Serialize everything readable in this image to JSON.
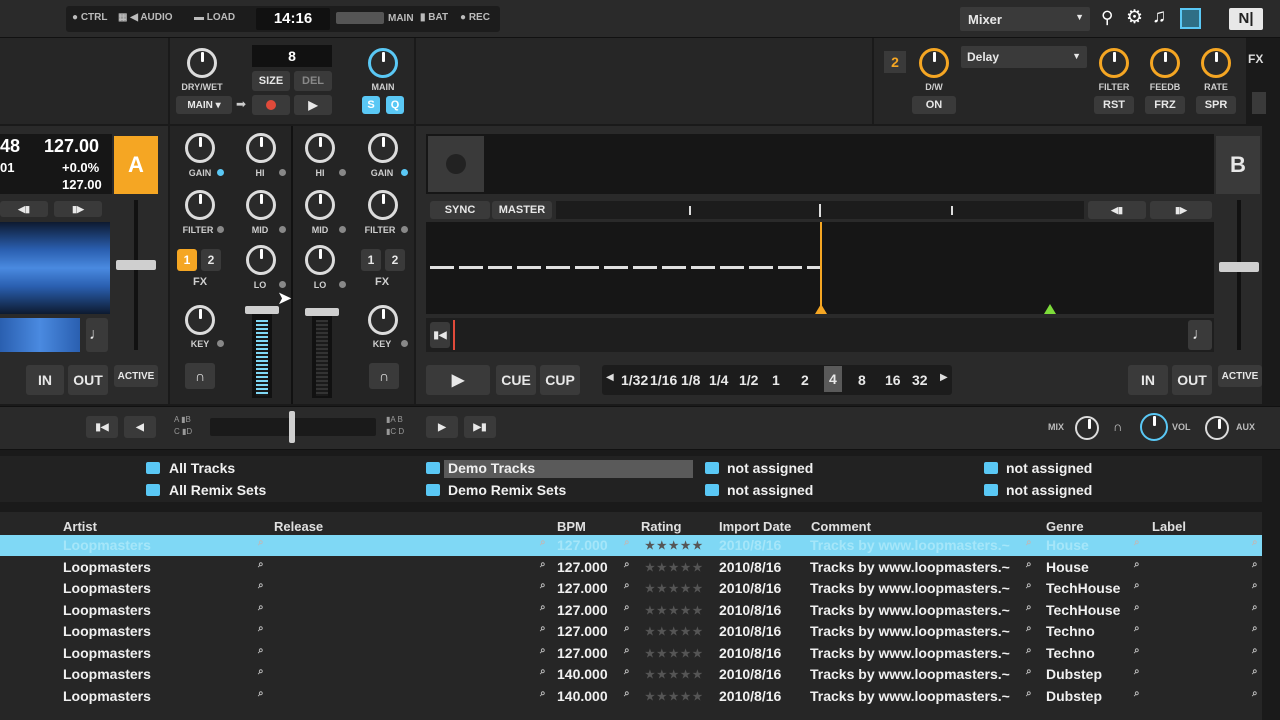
{
  "topbar": {
    "ctrl": "CTRL",
    "audio": "AUDIO",
    "load": "LOAD",
    "time": "14:16",
    "main": "MAIN",
    "bat": "BAT",
    "rec": "REC",
    "layout_select": "Mixer"
  },
  "fx1": {
    "drywet": "DRY/WET",
    "beats": "8",
    "size": "SIZE",
    "del": "DEL",
    "main_select": "MAIN",
    "main_knob": "MAIN",
    "s": "S",
    "q": "Q"
  },
  "fx2": {
    "unit": "2",
    "effect": "Delay",
    "dw": "D/W",
    "on": "ON",
    "filter": "FILTER",
    "feedb": "FEEDB",
    "rate": "RATE",
    "rst": "RST",
    "frz": "FRZ",
    "spr": "SPR",
    "fx_tab": "FX"
  },
  "deckA": {
    "bpm": "127.00",
    "pitch": "+0.0%",
    "tempo": "127.00",
    "pos1": "48",
    "pos2": "01",
    "letter": "A",
    "in": "IN",
    "out": "OUT",
    "active": "ACTIVE"
  },
  "mixer": {
    "gain": "GAIN",
    "hi": "HI",
    "mid": "MID",
    "lo": "LO",
    "filter": "FILTER",
    "fx": "FX",
    "key": "KEY",
    "fx1": "1",
    "fx2": "2"
  },
  "deckB": {
    "letter": "B",
    "sync": "SYNC",
    "master": "MASTER",
    "cue": "CUE",
    "cup": "CUP",
    "in": "IN",
    "out": "OUT",
    "active": "ACTIVE",
    "loop_sizes": [
      "1/32",
      "1/16",
      "1/8",
      "1/4",
      "1/2",
      "1",
      "2",
      "4",
      "8",
      "16",
      "32"
    ],
    "loop_selected": "4"
  },
  "transport": {
    "a": "A",
    "b": "B",
    "c": "C",
    "d": "D",
    "mix": "MIX",
    "vol": "VOL",
    "aux": "AUX"
  },
  "favorites": {
    "all_tracks": "All Tracks",
    "all_remix": "All Remix Sets",
    "demo_tracks": "Demo Tracks",
    "demo_remix": "Demo Remix Sets",
    "na1": "not assigned",
    "na2": "not assigned",
    "na3": "not assigned",
    "na4": "not assigned"
  },
  "columns": {
    "artist": "Artist",
    "release": "Release",
    "bpm": "BPM",
    "rating": "Rating",
    "import": "Import Date",
    "comment": "Comment",
    "genre": "Genre",
    "label": "Label"
  },
  "rows": [
    {
      "artist": "Loopmasters",
      "bpm": "127.000",
      "date": "2010/8/16",
      "comment": "Tracks by www.loopmasters.~",
      "genre": "House"
    },
    {
      "artist": "Loopmasters",
      "bpm": "127.000",
      "date": "2010/8/16",
      "comment": "Tracks by www.loopmasters.~",
      "genre": "House"
    },
    {
      "artist": "Loopmasters",
      "bpm": "127.000",
      "date": "2010/8/16",
      "comment": "Tracks by www.loopmasters.~",
      "genre": "TechHouse"
    },
    {
      "artist": "Loopmasters",
      "bpm": "127.000",
      "date": "2010/8/16",
      "comment": "Tracks by www.loopmasters.~",
      "genre": "TechHouse"
    },
    {
      "artist": "Loopmasters",
      "bpm": "127.000",
      "date": "2010/8/16",
      "comment": "Tracks by www.loopmasters.~",
      "genre": "Techno"
    },
    {
      "artist": "Loopmasters",
      "bpm": "127.000",
      "date": "2010/8/16",
      "comment": "Tracks by www.loopmasters.~",
      "genre": "Techno"
    },
    {
      "artist": "Loopmasters",
      "bpm": "140.000",
      "date": "2010/8/16",
      "comment": "Tracks by www.loopmasters.~",
      "genre": "Dubstep"
    },
    {
      "artist": "Loopmasters",
      "bpm": "140.000",
      "date": "2010/8/16",
      "comment": "Tracks by www.loopmasters.~",
      "genre": "Dubstep"
    }
  ],
  "colors": {
    "accent_orange": "#f5a623",
    "accent_blue": "#5ac8f5",
    "selected_row": "#7fd8f5"
  }
}
